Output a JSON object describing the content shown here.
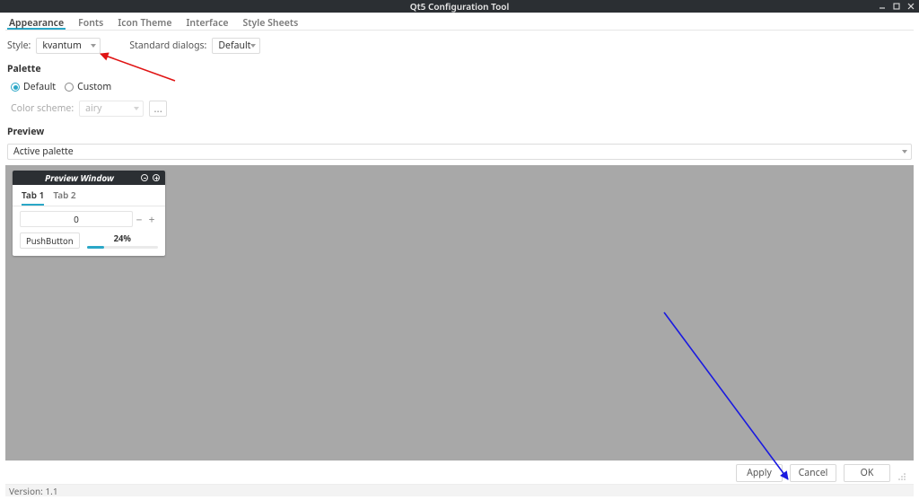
{
  "titlebar": {
    "title": "Qt5 Configuration Tool"
  },
  "tabs": {
    "appearance": "Appearance",
    "fonts": "Fonts",
    "icon_theme": "Icon Theme",
    "interface": "Interface",
    "style_sheets": "Style Sheets"
  },
  "style_row": {
    "label": "Style:",
    "value": "kvantum",
    "std_dlg_label": "Standard dialogs:",
    "std_dlg_value": "Default"
  },
  "palette": {
    "heading": "Palette",
    "default": "Default",
    "custom": "Custom",
    "color_scheme_label": "Color scheme:",
    "color_scheme_value": "airy",
    "browse": "..."
  },
  "preview": {
    "heading": "Preview",
    "palette_combo": "Active palette",
    "window_title": "Preview Window",
    "tab1": "Tab 1",
    "tab2": "Tab 2",
    "spin_value": "0",
    "push_button": "PushButton",
    "progress_pct": "24%"
  },
  "buttons": {
    "apply": "Apply",
    "cancel": "Cancel",
    "ok": "OK"
  },
  "status": {
    "version": "Version: 1.1"
  }
}
